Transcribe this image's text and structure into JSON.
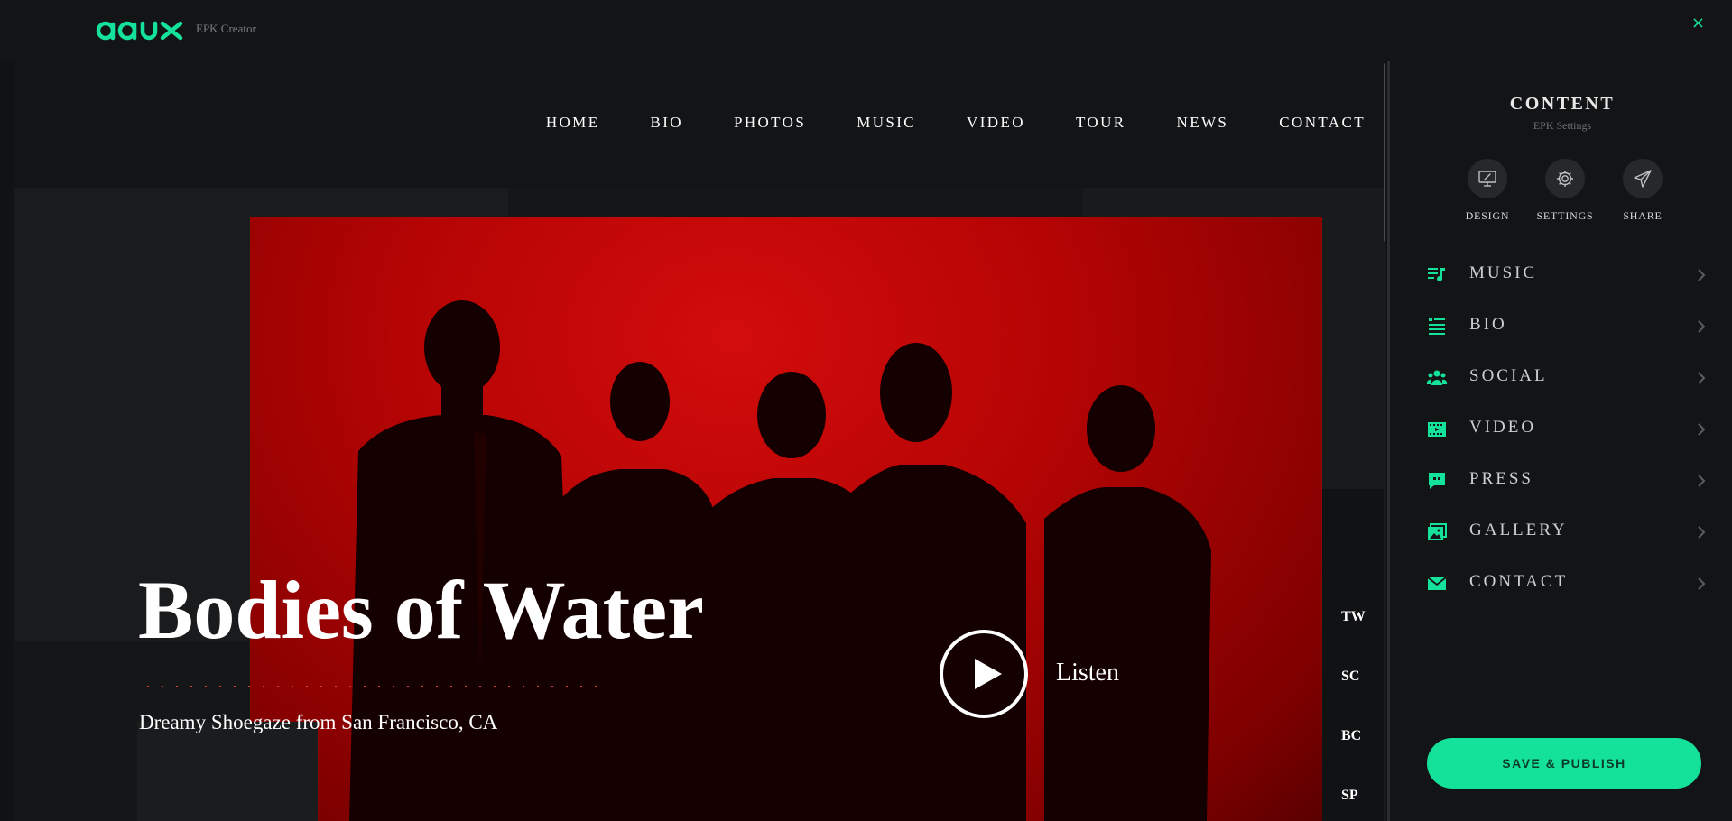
{
  "app": {
    "logo_text": "aaux",
    "subtitle": "EPK Creator",
    "close_glyph": "×"
  },
  "site": {
    "nav": [
      "HOME",
      "BIO",
      "PHOTOS",
      "MUSIC",
      "VIDEO",
      "TOUR",
      "NEWS",
      "CONTACT"
    ],
    "hero": {
      "title": "Bodies of Water",
      "tagline": "Dreamy Shoegaze from San Francisco, CA",
      "listen_label": "Listen",
      "photo_color": "#c80606"
    },
    "social": [
      "TW",
      "SC",
      "BC",
      "SP"
    ]
  },
  "sidebar": {
    "title": "CONTENT",
    "subtitle": "EPK Settings",
    "tools": [
      {
        "label": "DESIGN",
        "icon": "monitor-icon"
      },
      {
        "label": "SETTINGS",
        "icon": "gear-icon"
      },
      {
        "label": "SHARE",
        "icon": "paper-plane-icon"
      }
    ],
    "menu": [
      {
        "label": "MUSIC",
        "icon": "music-list-icon"
      },
      {
        "label": "BIO",
        "icon": "bio-list-icon"
      },
      {
        "label": "SOCIAL",
        "icon": "people-icon"
      },
      {
        "label": "VIDEO",
        "icon": "film-icon"
      },
      {
        "label": "PRESS",
        "icon": "quote-bubble-icon"
      },
      {
        "label": "GALLERY",
        "icon": "image-icon"
      },
      {
        "label": "CONTACT",
        "icon": "envelope-icon"
      }
    ],
    "save_label": "SAVE & PUBLISH"
  },
  "colors": {
    "accent": "#14e29a",
    "background": "#111214",
    "sidebar": "#131416"
  }
}
